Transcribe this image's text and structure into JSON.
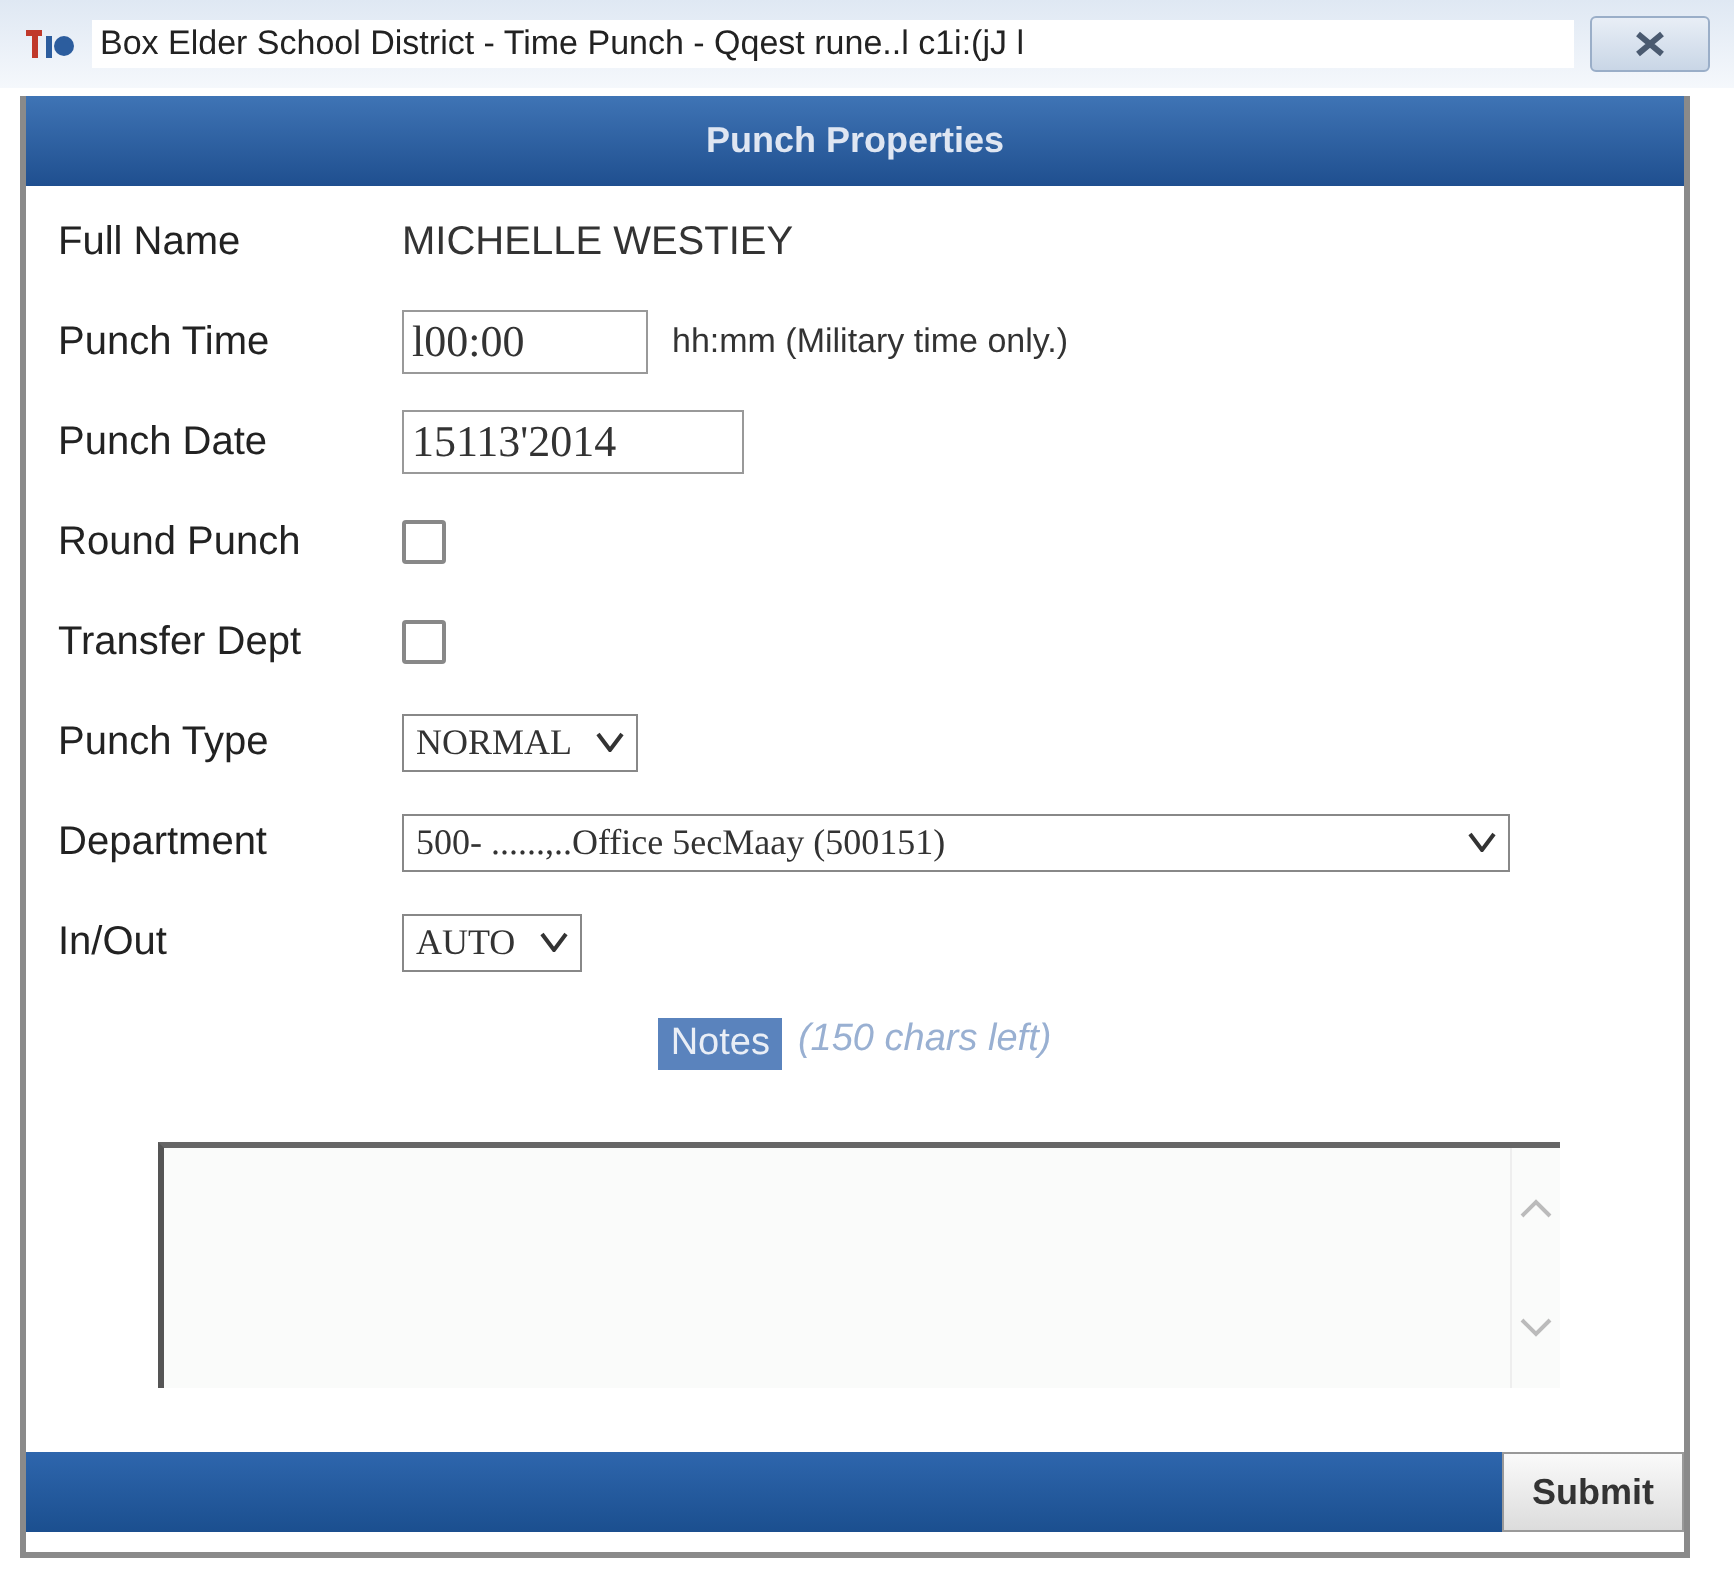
{
  "window": {
    "title": "Box Elder School District - Time Punch - Qqest rune..l c1i:(jJ l"
  },
  "dialog": {
    "title": "Punch Properties"
  },
  "fields": [
    {
      "kind": "text",
      "label": "Full Name",
      "value": "MICHELLE WESTIEY"
    },
    {
      "kind": "input",
      "label": "Punch Time",
      "value": "l00:00",
      "hint": "hh:mm (Military time only.)"
    },
    {
      "kind": "input",
      "label": "Punch Date",
      "value": "15113'2014"
    },
    {
      "kind": "checkbox",
      "label": "Round Punch",
      "checked": false
    },
    {
      "kind": "checkbox",
      "label": "Transfer Dept",
      "checked": false
    },
    {
      "kind": "select",
      "label": "Punch Type",
      "value": "NORMAL"
    },
    {
      "kind": "select",
      "label": "Department",
      "value": "500- ......,..Office 5ecMaay (500151)",
      "wide": true
    },
    {
      "kind": "select",
      "label": "In/Out",
      "value": "AUTO"
    }
  ],
  "notes": {
    "label": "Notes",
    "counter": "(150 chars left)"
  },
  "buttons": [
    {
      "label": "Submit"
    }
  ]
}
